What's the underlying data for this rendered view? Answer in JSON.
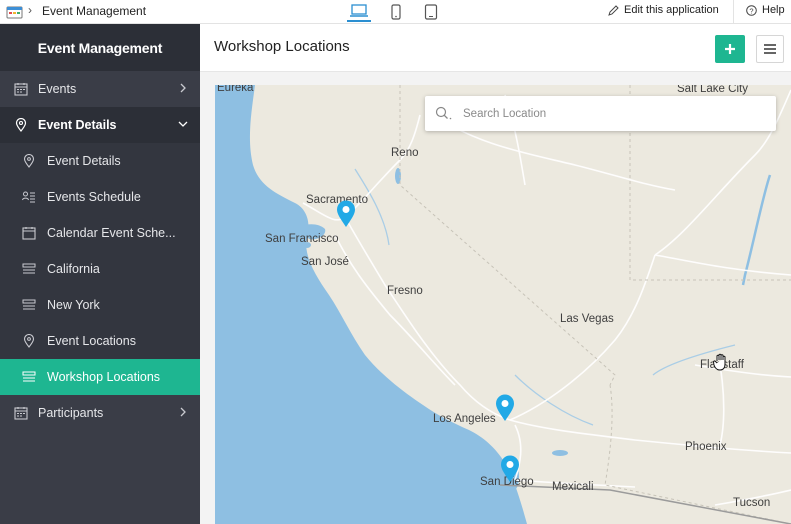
{
  "topbar": {
    "breadcrumb": "Event Management",
    "edit_label": "Edit this application",
    "help_label": "Help"
  },
  "sidebar": {
    "title": "Event Management",
    "items": [
      {
        "label": "Events",
        "icon": "calendar-icon"
      },
      {
        "label": "Event Details",
        "icon": "location-pin-icon"
      },
      {
        "label": "Event Details",
        "icon": "location-pin-icon"
      },
      {
        "label": "Events Schedule",
        "icon": "schedule-list-icon"
      },
      {
        "label": "Calendar Event Sche...",
        "icon": "calendar-icon"
      },
      {
        "label": "California",
        "icon": "list-icon"
      },
      {
        "label": "New York",
        "icon": "list-icon"
      },
      {
        "label": "Event Locations",
        "icon": "location-pin-icon"
      },
      {
        "label": "Workshop Locations",
        "icon": "list-icon"
      },
      {
        "label": "Participants",
        "icon": "calendar-icon"
      }
    ]
  },
  "content": {
    "title": "Workshop Locations"
  },
  "map": {
    "search_placeholder": "Search Location",
    "cities": [
      "Eureka",
      "Salt Lake City",
      "Reno",
      "Sacramento",
      "San Francisco",
      "San José",
      "Fresno",
      "Las Vegas",
      "Flagstaff",
      "Los Angeles",
      "Phoenix",
      "San Diego",
      "Mexicali",
      "Tucson"
    ],
    "colors": {
      "land": "#ece9df",
      "water": "#8ebfe2",
      "marker": "#22a9e6",
      "accent": "#1eb691"
    }
  }
}
